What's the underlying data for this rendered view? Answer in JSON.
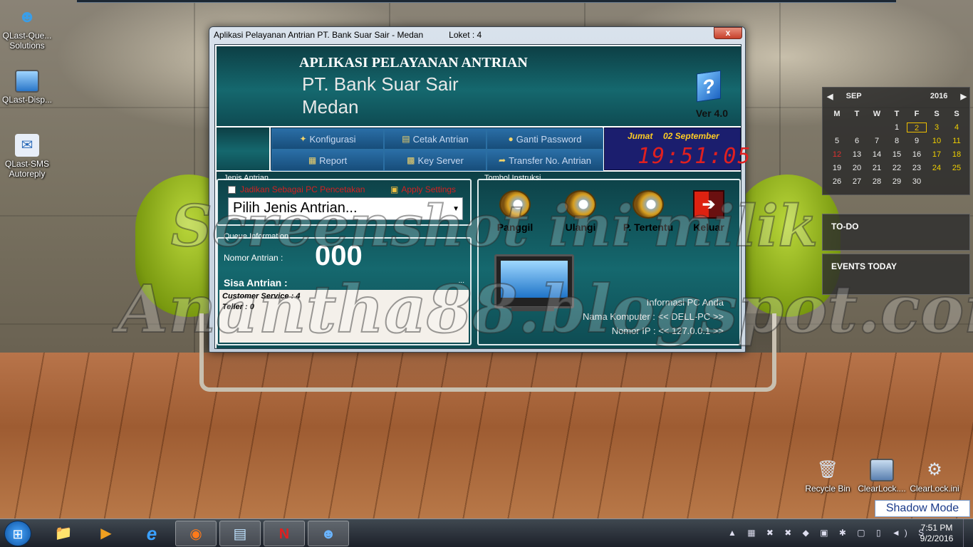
{
  "desktop": {
    "icons_left": [
      {
        "label": "QLast-Que...\nSolutions",
        "icon": "people-icon"
      },
      {
        "label": "QLast-Disp...",
        "icon": "monitor-icon"
      },
      {
        "label": "QLast-SMS\nAutoreply",
        "icon": "envelope-icon"
      }
    ],
    "icons_right": [
      {
        "label": "Recycle Bin",
        "icon": "recycle-bin-icon"
      },
      {
        "label": "ClearLock....",
        "icon": "clearlock-icon"
      },
      {
        "label": "ClearLock.ini",
        "icon": "settings-file-icon"
      }
    ],
    "watermark_line1": "Screenshot ini milik",
    "watermark_line2": "Anantha88.blogspot.com"
  },
  "window": {
    "title": "Aplikasi Pelayanan Antrian PT. Bank Suar Sair - Medan",
    "loket": "Loket : 4",
    "close": "x"
  },
  "header": {
    "title": "APLIKASI PELAYANAN ANTRIAN",
    "company": "PT. Bank Suar Sair",
    "city": "Medan",
    "version": "Ver 4.0",
    "help_glyph": "?"
  },
  "menu": {
    "items": [
      {
        "label": "Konfigurasi",
        "icon": "gear-icon"
      },
      {
        "label": "Cetak Antrian",
        "icon": "printer-icon"
      },
      {
        "label": "Ganti Password",
        "icon": "lock-icon"
      },
      {
        "label": "Report",
        "icon": "report-icon"
      },
      {
        "label": "Key Server",
        "icon": "keypad-icon"
      },
      {
        "label": "Transfer No. Antrian",
        "icon": "transfer-arrow-icon"
      }
    ]
  },
  "clock": {
    "day": "Jumat",
    "date": "02 September",
    "time": "19:51:05"
  },
  "jenis": {
    "group_label": "Jenis Antrian",
    "checkbox_label": "Jadikan Sebagai PC Pencetakan",
    "apply_label": "Apply Settings",
    "combo_value": "Pilih Jenis Antrian..."
  },
  "queue": {
    "group_label": "Queue Information",
    "nomor_label": "Nomor Antrian :",
    "nomor_value": "000",
    "sisa_label": "Sisa Antrian :",
    "dots": "...",
    "lines": [
      "Customer Service : 4",
      "Teller : 0"
    ]
  },
  "tombol": {
    "group_label": "Tombol Instruksi",
    "buttons": [
      "Panggil",
      "Ulangi",
      "P. Tertentu",
      "Keluar"
    ],
    "info_title": "Informasi PC Anda",
    "nama_komputer": "Nama Komputer : << DELL-PC >>",
    "nomor_ip": "Nomor IP : << 127.0.0.1 >>"
  },
  "calendar": {
    "month": "SEP",
    "year": "2016",
    "weekdays": [
      "M",
      "T",
      "W",
      "T",
      "F",
      "S",
      "S"
    ],
    "weeks": [
      [
        "",
        "",
        "",
        "1",
        "2",
        "3",
        "4"
      ],
      [
        "5",
        "6",
        "7",
        "8",
        "9",
        "10",
        "11"
      ],
      [
        "12",
        "13",
        "14",
        "15",
        "16",
        "17",
        "18"
      ],
      [
        "19",
        "20",
        "21",
        "22",
        "23",
        "24",
        "25"
      ],
      [
        "26",
        "27",
        "28",
        "29",
        "30",
        "",
        ""
      ]
    ],
    "today": "2",
    "holiday": "12"
  },
  "gadgets": {
    "todo": "TO-DO",
    "events": "EVENTS TODAY"
  },
  "shadow_mode": "Shadow Mode",
  "taskbar": {
    "time": "7:51 PM",
    "date": "9/2/2016",
    "apps": [
      {
        "name": "explorer-icon",
        "glyph": "📁"
      },
      {
        "name": "media-player-icon",
        "glyph": "▶"
      },
      {
        "name": "internet-explorer-icon",
        "glyph": "e"
      },
      {
        "name": "firefox-icon",
        "glyph": "◉"
      },
      {
        "name": "document-icon",
        "glyph": "▤"
      },
      {
        "name": "red-app-icon",
        "glyph": "N"
      },
      {
        "name": "qlast-people-icon",
        "glyph": "☻"
      }
    ],
    "tray_glyphs": "▲ ▦ ✖ ✖ ◆ ▣ ✱ ▢ ▯ ◄) S"
  }
}
